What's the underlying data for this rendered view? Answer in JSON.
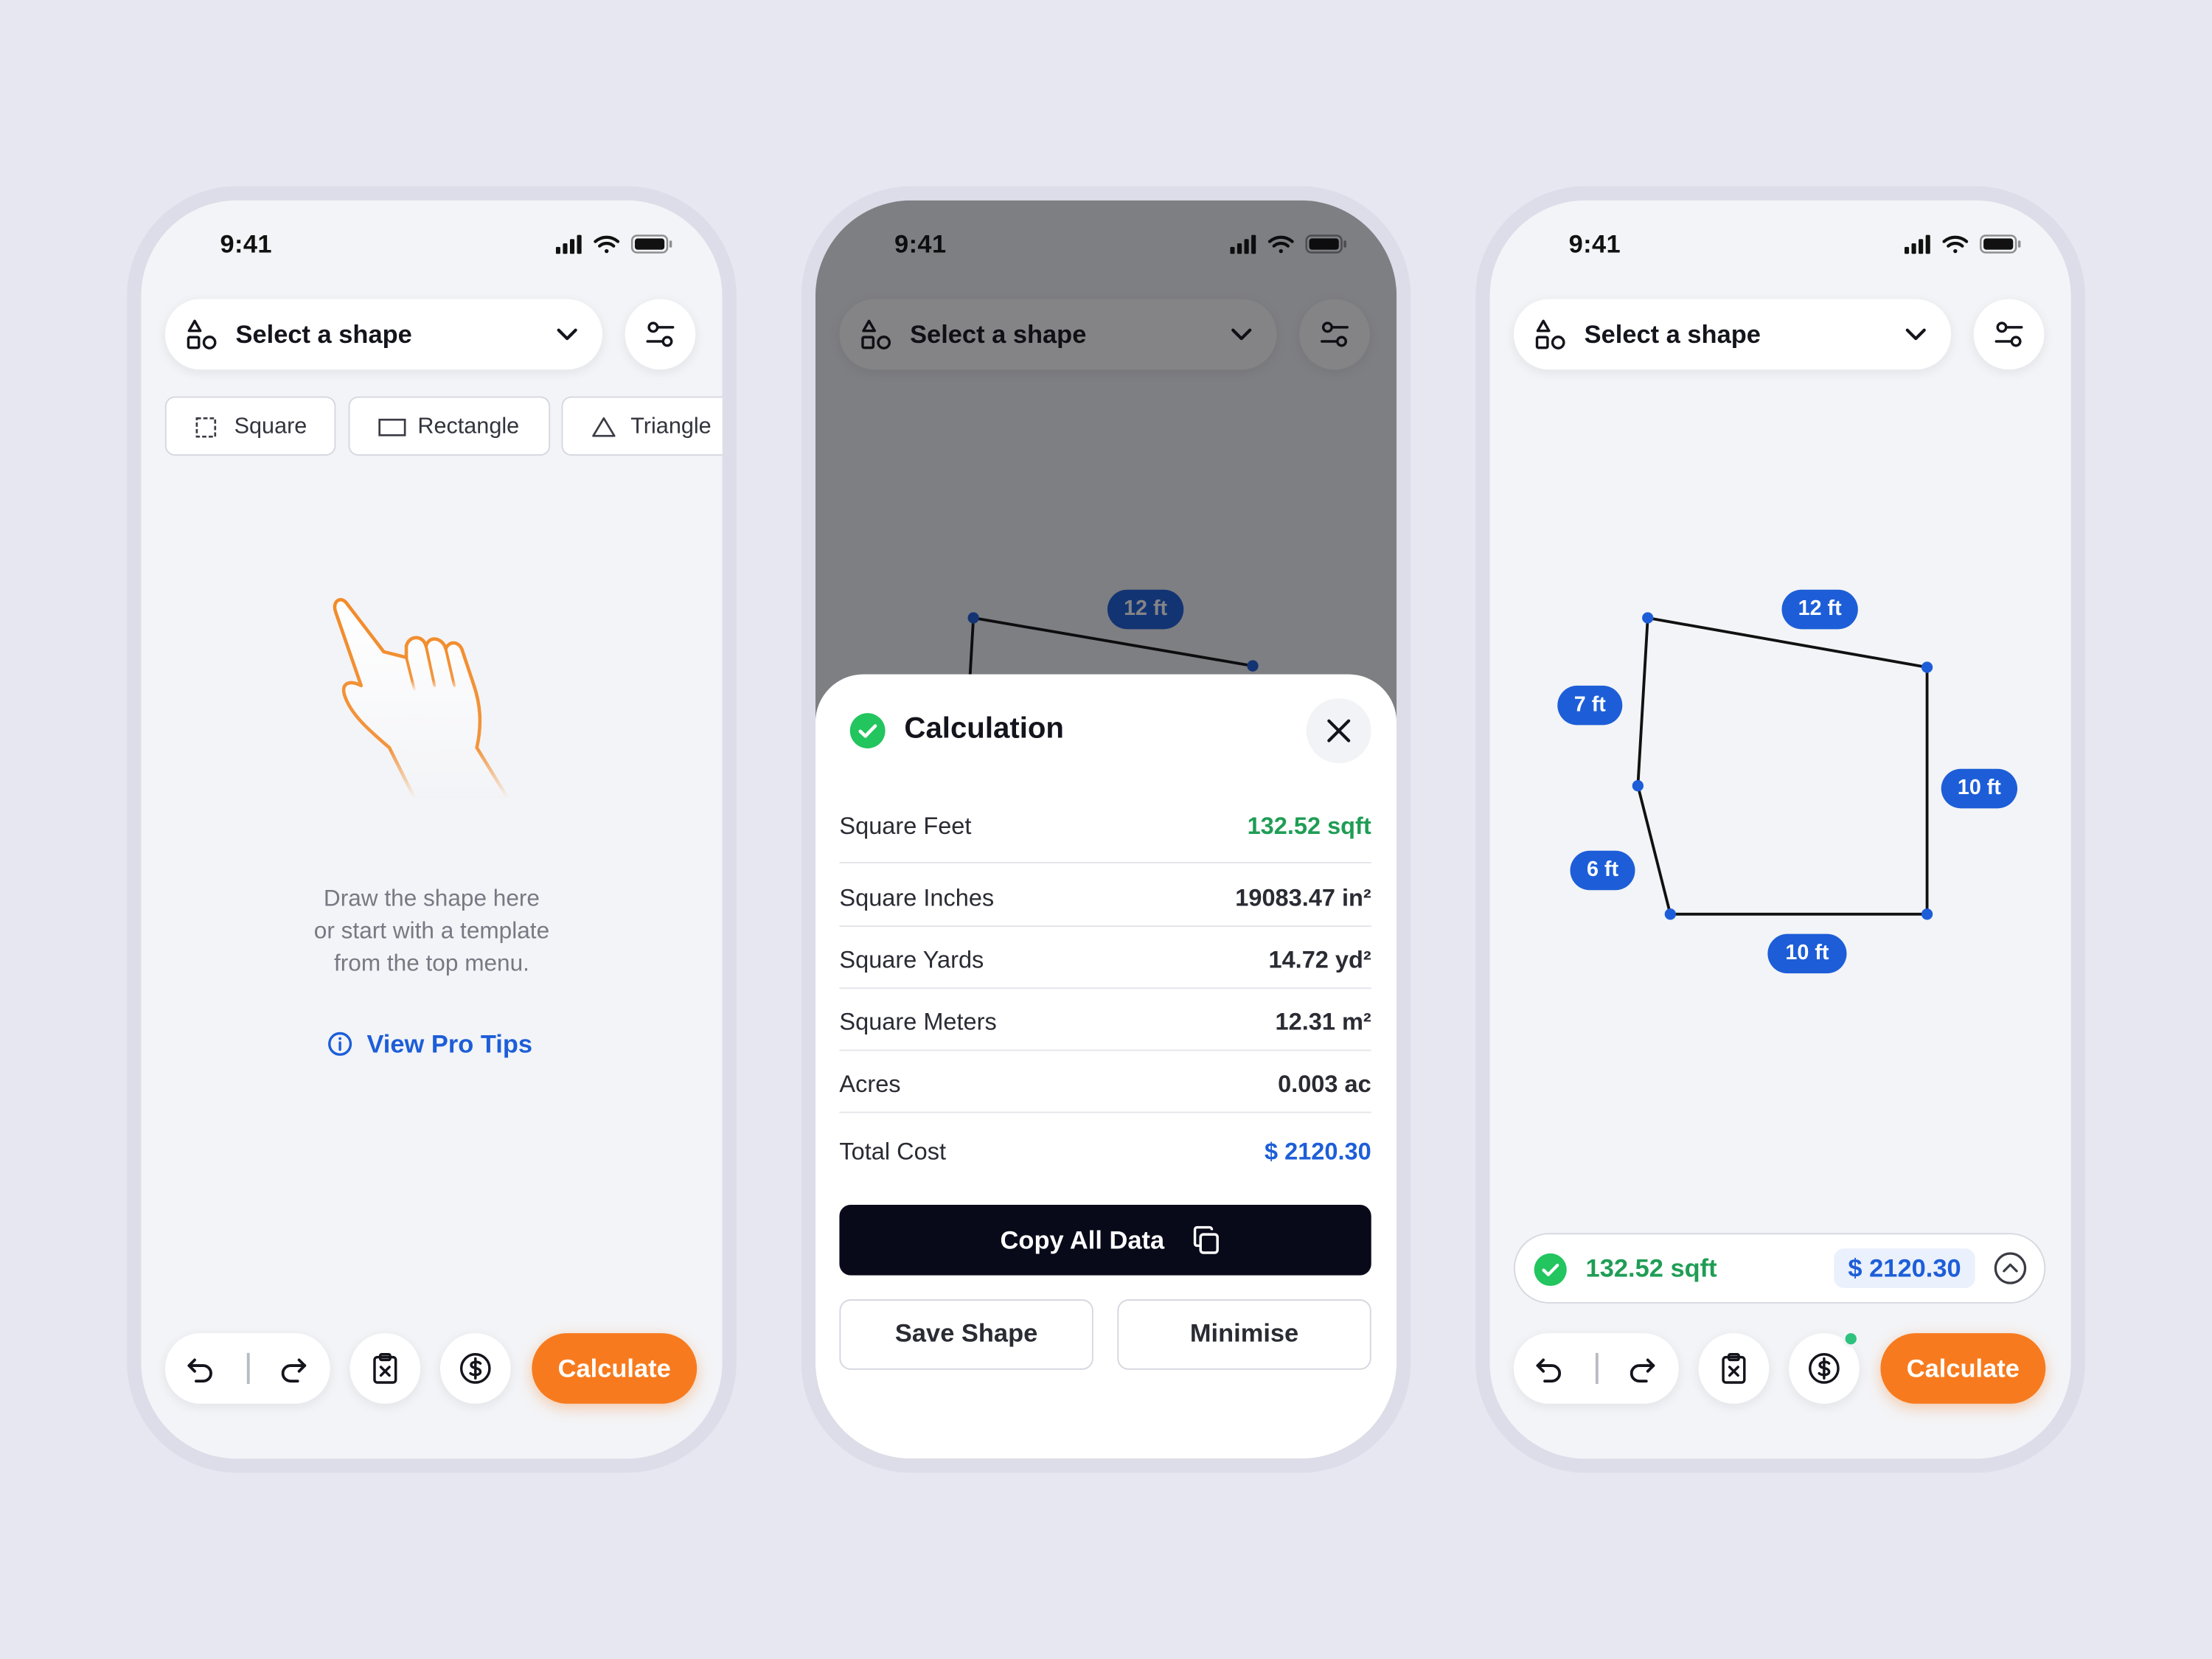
{
  "status": {
    "time": "9:41"
  },
  "toolbar": {
    "dropdown_label": "Select a shape",
    "calculate_label": "Calculate"
  },
  "templates": [
    {
      "label": "Square",
      "icon": "square-icon"
    },
    {
      "label": "Rectangle",
      "icon": "rectangle-icon"
    },
    {
      "label": "Triangle",
      "icon": "triangle-icon"
    }
  ],
  "empty_state": {
    "hint_lines": [
      "Draw the shape here",
      "or start with a template",
      "from the top menu."
    ],
    "pro_tips_label": "View Pro Tips"
  },
  "calculation": {
    "title": "Calculation",
    "rows": [
      {
        "label": "Square Feet",
        "value": "132.52 sqft"
      },
      {
        "label": "Square Inches",
        "value": "19083.47 in²"
      },
      {
        "label": "Square Yards",
        "value": "14.72 yd²"
      },
      {
        "label": "Square Meters",
        "value": "12.31 m²"
      },
      {
        "label": "Acres",
        "value": "0.003 ac"
      },
      {
        "label": "Total Cost",
        "value": "$ 2120.30"
      }
    ],
    "copy_label": "Copy All Data",
    "save_label": "Save Shape",
    "minimise_label": "Minimise"
  },
  "shape": {
    "edges": [
      {
        "label": "12 ft"
      },
      {
        "label": "7 ft"
      },
      {
        "label": "10 ft"
      },
      {
        "label": "6 ft"
      },
      {
        "label": "10 ft"
      }
    ]
  },
  "summary": {
    "area": "132.52 sqft",
    "cost": "$ 2120.30"
  },
  "colors": {
    "accent_orange": "#f77b1e",
    "accent_blue": "#1d5ed8",
    "success_green": "#1f9d55",
    "dark_button": "#080a1a"
  }
}
